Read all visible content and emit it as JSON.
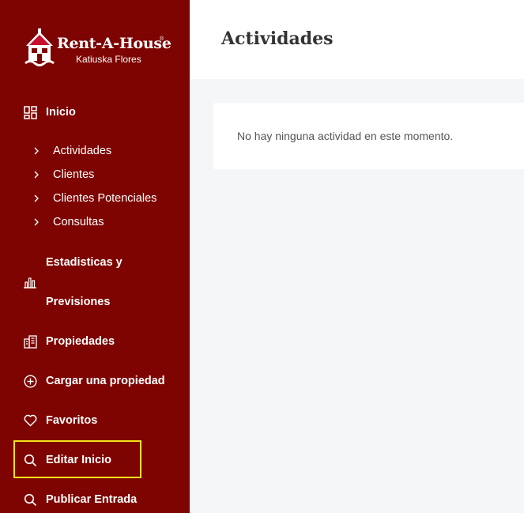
{
  "brand": {
    "title": "Rent-A-House",
    "registered": "®",
    "subtitle": "Katiuska Flores",
    "sidebar_color": "#7d0400"
  },
  "nav": {
    "inicio": {
      "label": "Inicio",
      "icon": "dashboard-icon"
    },
    "submenu": [
      {
        "label": "Actividades",
        "icon": "chevron-right-icon"
      },
      {
        "label": "Clientes",
        "icon": "chevron-right-icon"
      },
      {
        "label": "Clientes Potenciales",
        "icon": "chevron-right-icon"
      },
      {
        "label": "Consultas",
        "icon": "chevron-right-icon"
      }
    ],
    "stats": {
      "line1": "Estadisticas y",
      "line2": "Previsiones",
      "icon": "bar-chart-icon"
    },
    "propiedades": {
      "label": "Propiedades",
      "icon": "building-icon"
    },
    "cargar": {
      "label": "Cargar una propiedad",
      "icon": "plus-circle-icon"
    },
    "favoritos": {
      "label": "Favoritos",
      "icon": "heart-icon"
    },
    "editar": {
      "label": "Editar Inicio",
      "icon": "search-icon"
    },
    "publicar": {
      "label": "Publicar Entrada",
      "icon": "search-icon"
    }
  },
  "main": {
    "title": "Actividades",
    "empty_message": "No hay ninguna actividad en este momento."
  }
}
